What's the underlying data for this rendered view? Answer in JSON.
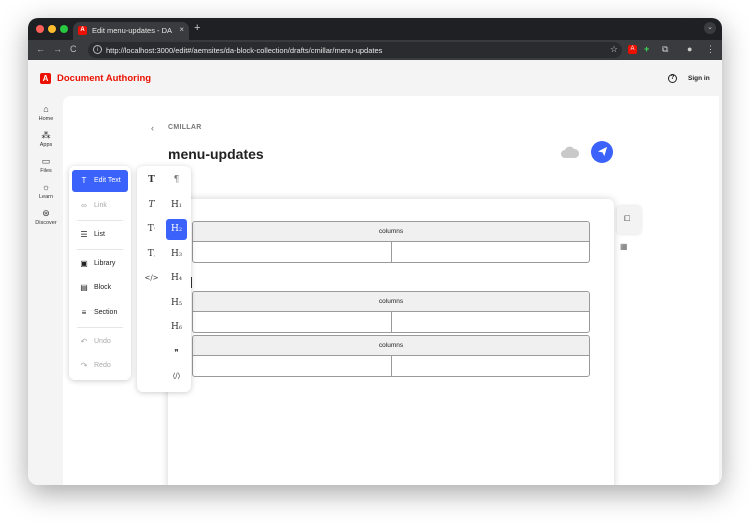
{
  "browser": {
    "tab_title": "Edit menu-updates - DA",
    "tab_close": "×",
    "new_tab": "+",
    "url": "http://localhost:3000/edit#/aemsites/da-block-collection/drafts/cmillar/menu-updates",
    "nav": {
      "back": "←",
      "forward": "→",
      "reload": "C"
    }
  },
  "app": {
    "brand_name": "Document Authoring",
    "sign_in": "Sign in",
    "nav": [
      {
        "label": "Home",
        "icon": "home-icon"
      },
      {
        "label": "Apps",
        "icon": "apps-icon"
      },
      {
        "label": "Files",
        "icon": "folder-icon"
      },
      {
        "label": "Learn",
        "icon": "lightbulb-icon"
      },
      {
        "label": "Discover",
        "icon": "compass-icon"
      }
    ]
  },
  "document": {
    "breadcrumb": "CMILLAR",
    "title": "menu-updates",
    "blocks": [
      {
        "header": "columns"
      },
      {
        "header": "columns"
      },
      {
        "header": "columns"
      }
    ]
  },
  "insert_menu": {
    "items": [
      {
        "label": "Edit Text",
        "icon": "text-icon",
        "state": "active"
      },
      {
        "label": "Link",
        "icon": "link-icon",
        "state": "disabled"
      },
      {
        "label": "List",
        "icon": "list-icon",
        "state": "normal"
      },
      {
        "label": "Library",
        "icon": "library-icon",
        "state": "normal"
      },
      {
        "label": "Block",
        "icon": "block-icon",
        "state": "normal"
      },
      {
        "label": "Section",
        "icon": "section-icon",
        "state": "normal"
      },
      {
        "label": "Undo",
        "icon": "undo-icon",
        "state": "disabled"
      },
      {
        "label": "Redo",
        "icon": "redo-icon",
        "state": "disabled"
      }
    ]
  },
  "text_menu": {
    "left": [
      {
        "icon": "bold-text-icon",
        "glyph": "T"
      },
      {
        "icon": "italic-text-icon",
        "glyph": "T"
      },
      {
        "icon": "superscript-icon",
        "glyph": "T'"
      },
      {
        "icon": "subscript-icon",
        "glyph": "T,"
      },
      {
        "icon": "code-icon",
        "glyph": "</>"
      }
    ],
    "right": [
      {
        "icon": "paragraph-icon",
        "glyph": "¶"
      },
      {
        "icon": "heading-1-icon",
        "glyph": "H1"
      },
      {
        "icon": "heading-2-icon",
        "glyph": "H2",
        "selected": true
      },
      {
        "icon": "heading-3-icon",
        "glyph": "H3"
      },
      {
        "icon": "heading-4-icon",
        "glyph": "H4"
      },
      {
        "icon": "heading-5-icon",
        "glyph": "H5"
      },
      {
        "icon": "heading-6-icon",
        "glyph": "H6"
      },
      {
        "icon": "blockquote-icon",
        "glyph": "❞"
      },
      {
        "icon": "code-block-icon",
        "glyph": "⟨/⟩"
      }
    ]
  },
  "colors": {
    "accent": "#3b63fb",
    "brand": "#eb1000"
  }
}
